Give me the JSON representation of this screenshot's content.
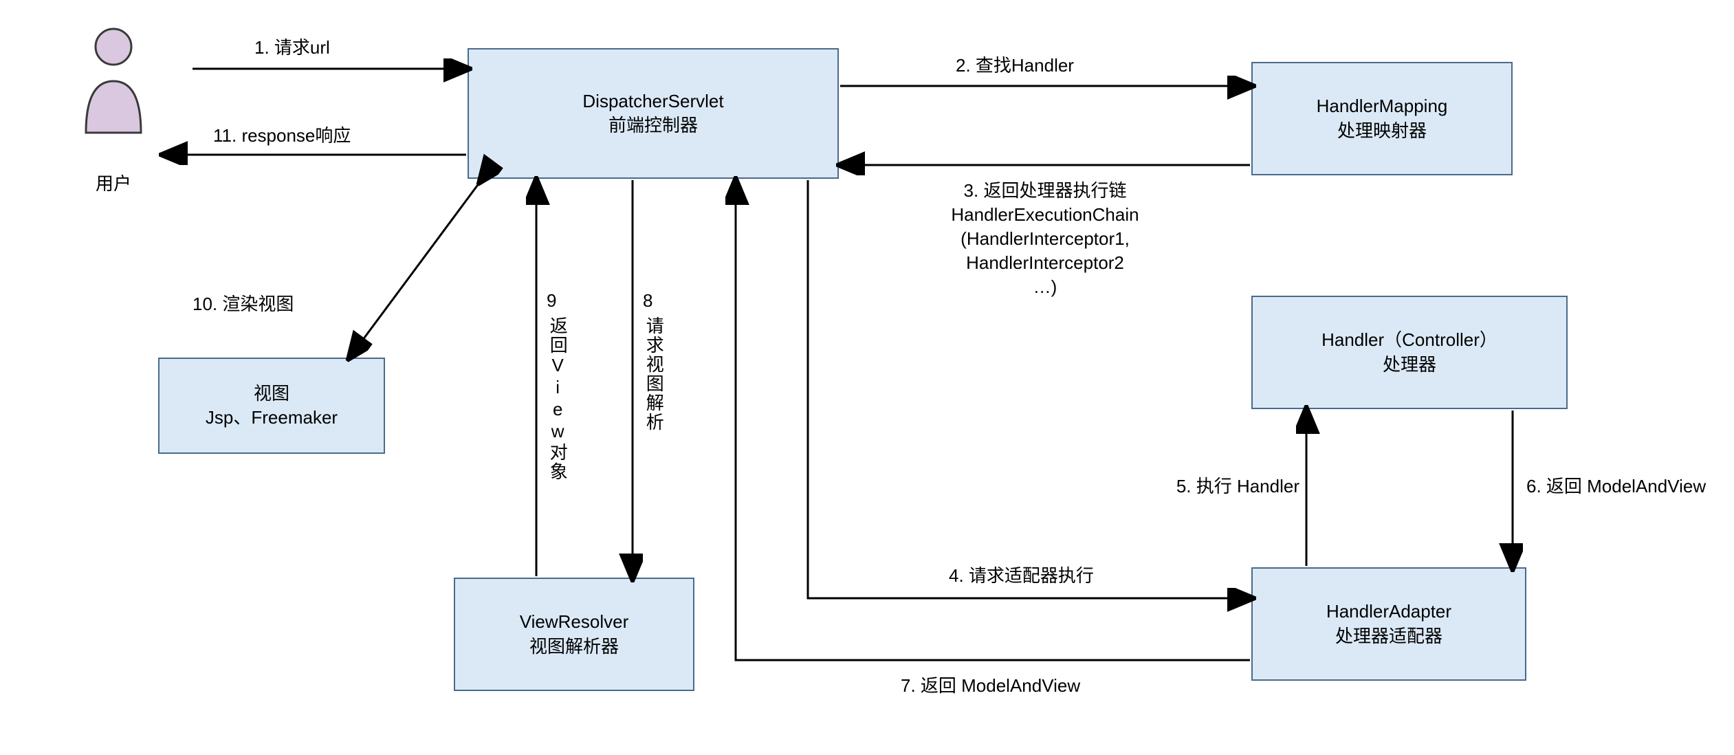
{
  "user": {
    "label": "用户"
  },
  "boxes": {
    "dispatcher": {
      "line1": "DispatcherServlet",
      "line2": "前端控制器"
    },
    "handlerMapping": {
      "line1": "HandlerMapping",
      "line2": "处理映射器"
    },
    "handler": {
      "line1": "Handler（Controller）",
      "line2": "处理器"
    },
    "handlerAdapter": {
      "line1": "HandlerAdapter",
      "line2": "处理器适配器"
    },
    "viewResolver": {
      "line1": "ViewResolver",
      "line2": "视图解析器"
    },
    "view": {
      "line1": "视图",
      "line2": "Jsp、Freemaker"
    }
  },
  "edges": {
    "e1": "1. 请求url",
    "e2": "2. 查找Handler",
    "e3": "3. 返回处理器执行链\nHandlerExecutionChain\n(HandlerInterceptor1,\nHandlerInterceptor2\n…)",
    "e4": "4. 请求适配器执行",
    "e5": "5. 执行 Handler",
    "e6": "6. 返回 ModelAndView",
    "e7": "7. 返回 ModelAndView",
    "e8a": "8",
    "e8b": "请求视图解析",
    "e9a": "9",
    "e9b": "返回View对象",
    "e10": "10. 渲染视图",
    "e11": "11. response响应"
  }
}
